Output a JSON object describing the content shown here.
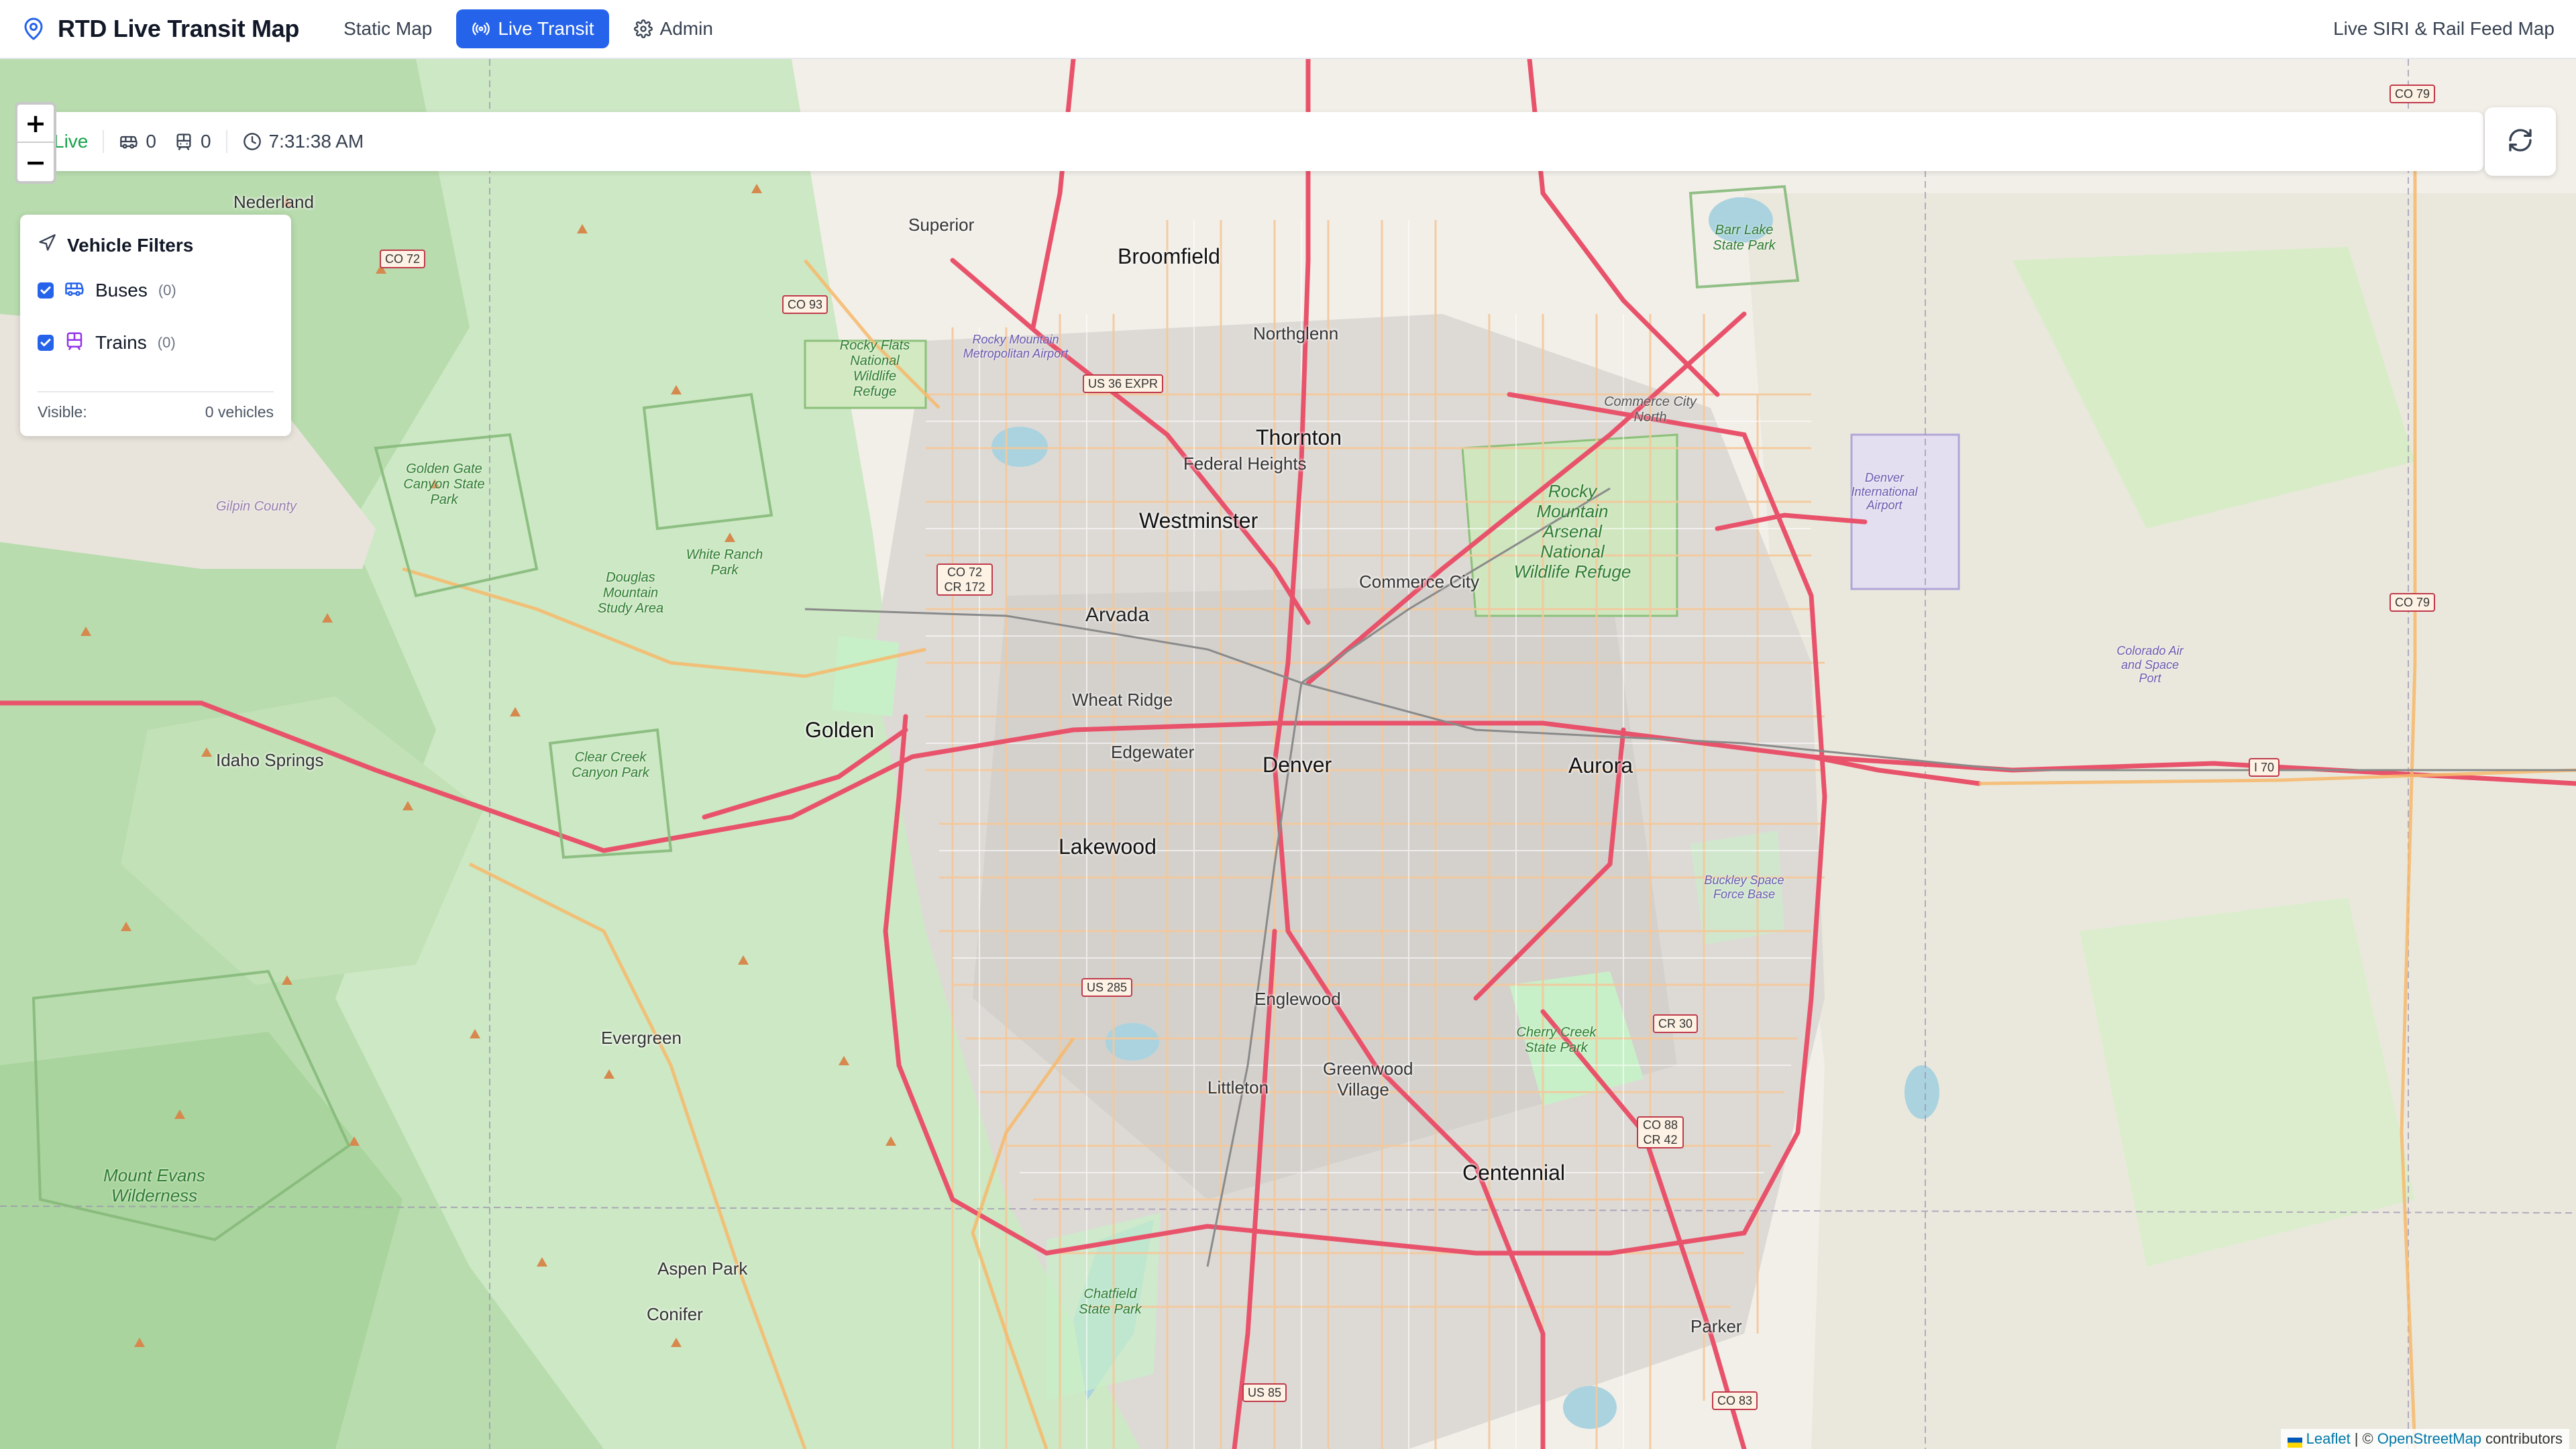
{
  "header": {
    "title": "RTD Live Transit Map",
    "nav": [
      {
        "label": "Static Map"
      },
      {
        "label": "Live Transit"
      },
      {
        "label": "Admin"
      }
    ],
    "right_text": "Live SIRI & Rail Feed Map"
  },
  "status": {
    "live_label": "Live",
    "bus_count": "0",
    "train_count": "0",
    "time": "7:31:38 AM"
  },
  "zoom": {
    "in": "+",
    "out": "−"
  },
  "filters": {
    "title": "Vehicle Filters",
    "items": [
      {
        "label": "Buses",
        "count": "(0)"
      },
      {
        "label": "Trains",
        "count": "(0)"
      }
    ],
    "visible_label": "Visible:",
    "visible_value": "0 vehicles"
  },
  "attribution": {
    "leaflet": "Leaflet",
    "separator": "| ©",
    "osm": "OpenStreetMap",
    "contributors": "contributors"
  },
  "map_labels": {
    "cities": [
      "Denver",
      "Aurora",
      "Lakewood",
      "Westminster",
      "Thornton",
      "Centennial",
      "Golden",
      "Arvada",
      "Broomfield"
    ],
    "towns": [
      "Nederland",
      "Superior",
      "Northglenn",
      "Federal Heights",
      "Commerce City",
      "Wheat Ridge",
      "Edgewater",
      "Englewood",
      "Littleton",
      "Greenwood Village",
      "Parker",
      "Evergreen",
      "Idaho Springs",
      "Aspen Park",
      "Conifer"
    ],
    "parks": [
      "Rocky Mountain Arsenal National Wildlife Refuge",
      "Barr Lake State Park",
      "Rocky Flats National Wildlife Refuge",
      "Golden Gate Canyon State Park",
      "White Ranch Park",
      "Douglas Mountain Study Area",
      "Clear Creek Canyon Park",
      "Cherry Creek State Park",
      "Chatfield State Park",
      "Mount Evans Wilderness",
      "Gilpin County",
      "Commerce City North"
    ],
    "airports": [
      "Rocky Mountain Metropolitan Airport",
      "Denver International Airport",
      "Colorado Air and Space Port",
      "Buckley Space Force Base"
    ],
    "shields": [
      "CO 79",
      "CO 72",
      "CO 93",
      "US 36 EXPR",
      "CO 72 CR 172",
      "US 285",
      "I 70",
      "CR 30",
      "CO 88 CR 42",
      "US 85",
      "CO 83",
      "CO 79"
    ]
  }
}
